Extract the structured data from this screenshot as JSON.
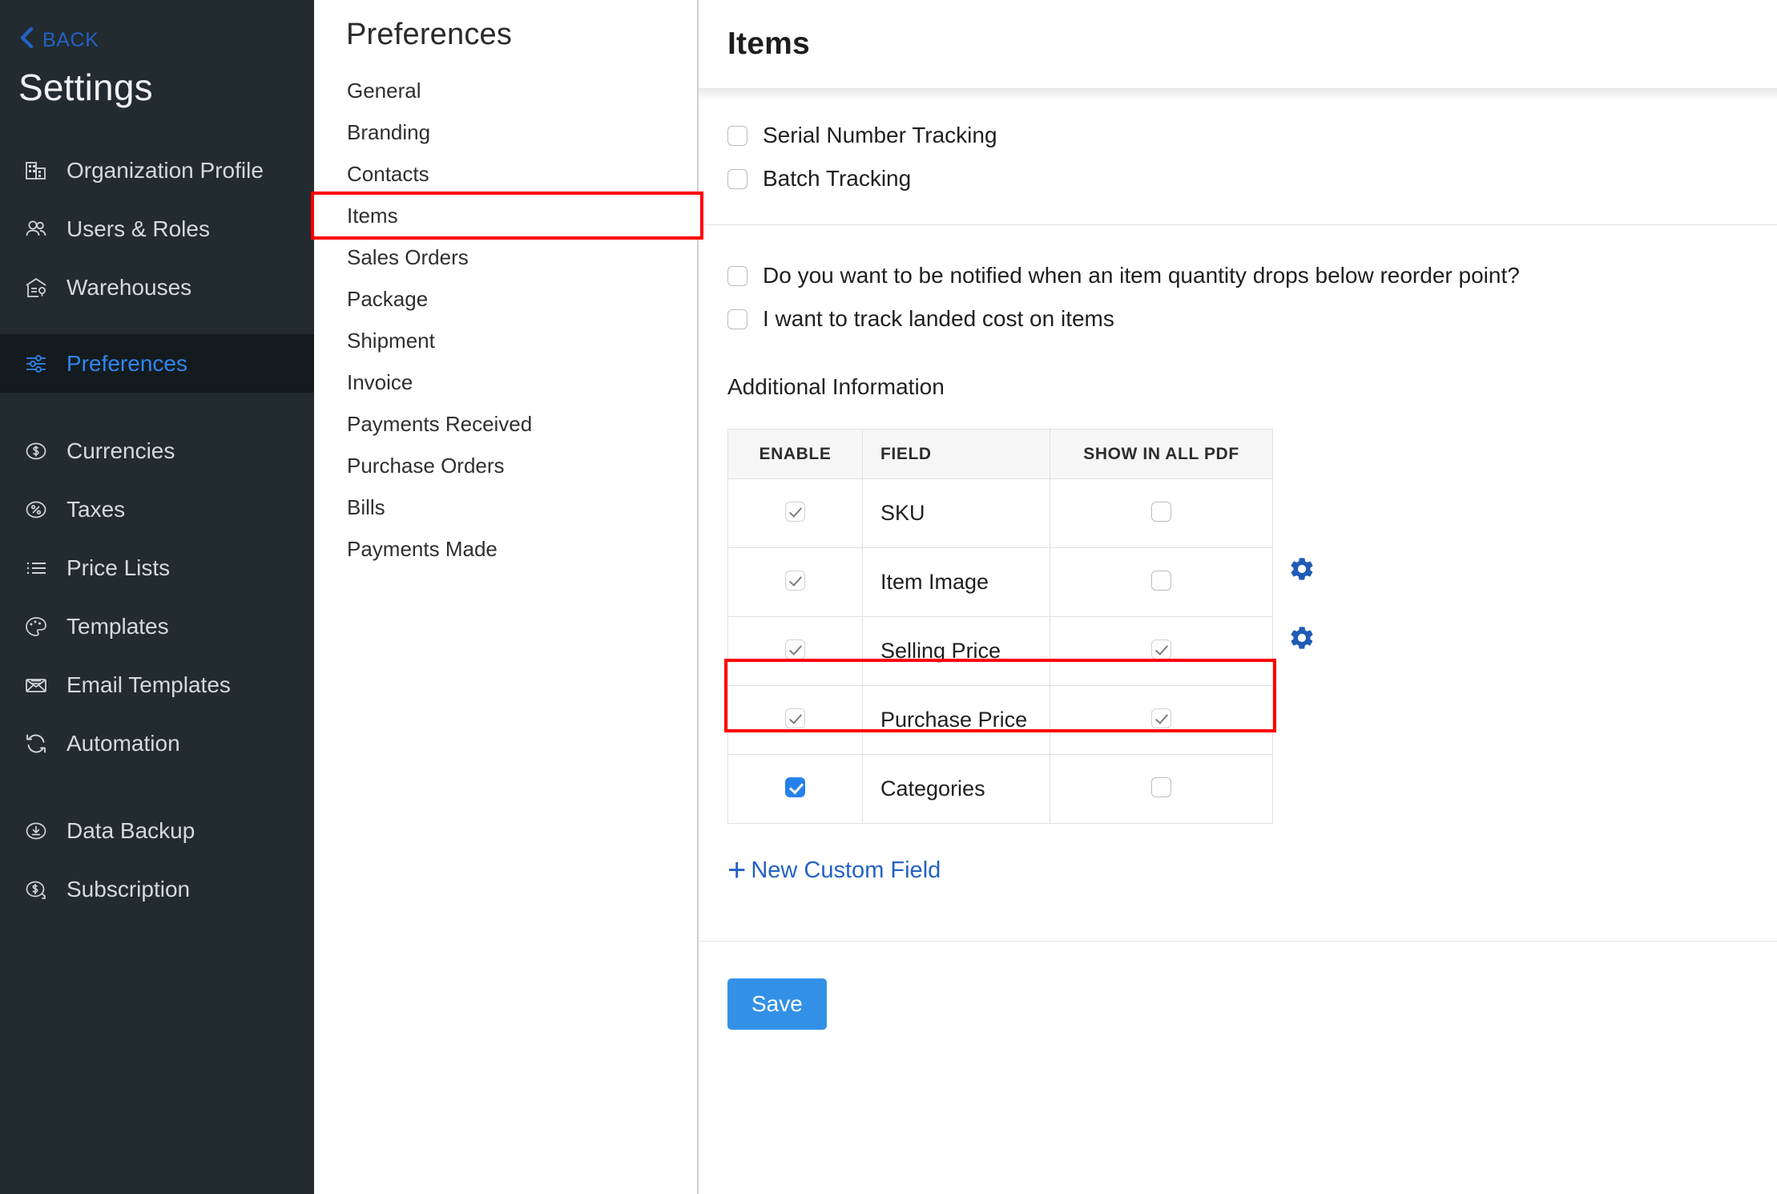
{
  "sidebar": {
    "back_label": "BACK",
    "title": "Settings",
    "groups": [
      {
        "items": [
          {
            "label": "Organization Profile",
            "icon": "building-icon",
            "active": false
          },
          {
            "label": "Users & Roles",
            "icon": "users-icon",
            "active": false
          },
          {
            "label": "Warehouses",
            "icon": "warehouse-icon",
            "active": false
          }
        ]
      },
      {
        "items": [
          {
            "label": "Preferences",
            "icon": "sliders-icon",
            "active": true
          }
        ]
      },
      {
        "items": [
          {
            "label": "Currencies",
            "icon": "dollar-circle-icon",
            "active": false
          },
          {
            "label": "Taxes",
            "icon": "percent-circle-icon",
            "active": false
          },
          {
            "label": "Price Lists",
            "icon": "list-icon",
            "active": false
          },
          {
            "label": "Templates",
            "icon": "palette-icon",
            "active": false
          },
          {
            "label": "Email Templates",
            "icon": "envelope-icon",
            "active": false
          },
          {
            "label": "Automation",
            "icon": "refresh-icon",
            "active": false
          }
        ]
      },
      {
        "items": [
          {
            "label": "Data Backup",
            "icon": "download-circle-icon",
            "active": false
          },
          {
            "label": "Subscription",
            "icon": "dollar-refresh-icon",
            "active": false
          }
        ]
      }
    ]
  },
  "preferences_panel": {
    "title": "Preferences",
    "items": [
      {
        "label": "General",
        "selected": false
      },
      {
        "label": "Branding",
        "selected": false
      },
      {
        "label": "Contacts",
        "selected": false
      },
      {
        "label": "Items",
        "selected": true
      },
      {
        "label": "Sales Orders",
        "selected": false
      },
      {
        "label": "Package",
        "selected": false
      },
      {
        "label": "Shipment",
        "selected": false
      },
      {
        "label": "Invoice",
        "selected": false
      },
      {
        "label": "Payments Received",
        "selected": false
      },
      {
        "label": "Purchase Orders",
        "selected": false
      },
      {
        "label": "Bills",
        "selected": false
      },
      {
        "label": "Payments Made",
        "selected": false
      }
    ]
  },
  "main": {
    "title": "Items",
    "tracking_options": [
      {
        "label": "Serial Number Tracking",
        "checked": false
      },
      {
        "label": "Batch Tracking",
        "checked": false
      }
    ],
    "notify_options": [
      {
        "label": "Do you want to be notified when an item quantity drops below reorder point?",
        "checked": false
      },
      {
        "label": "I want to track landed cost on items",
        "checked": false
      }
    ],
    "additional_information": {
      "section_label": "Additional Information",
      "columns": [
        "ENABLE",
        "FIELD",
        "SHOW IN ALL PDF"
      ],
      "rows": [
        {
          "field": "SKU",
          "enable": "checked-disabled",
          "show_in_pdf": "unchecked",
          "gear": false,
          "highlighted": false
        },
        {
          "field": "Item Image",
          "enable": "checked-disabled",
          "show_in_pdf": "unchecked",
          "gear": false,
          "highlighted": false
        },
        {
          "field": "Selling Price",
          "enable": "checked-disabled",
          "show_in_pdf": "checked-disabled",
          "gear": true,
          "highlighted": false
        },
        {
          "field": "Purchase Price",
          "enable": "checked-disabled",
          "show_in_pdf": "checked-disabled",
          "gear": true,
          "highlighted": false
        },
        {
          "field": "Categories",
          "enable": "checked",
          "show_in_pdf": "unchecked",
          "gear": false,
          "highlighted": true
        }
      ]
    },
    "new_custom_field_label": "New Custom Field",
    "new_custom_field_plus": "+",
    "save_label": "Save"
  },
  "colors": {
    "sidebar_bg": "#222b30",
    "sidebar_active_bg": "#141b1f",
    "accent_blue": "#2362c4",
    "link_blue": "#2e86ef",
    "checkbox_blue": "#2680eb",
    "gear_blue": "#1f5bb5",
    "save_blue": "#3291e6",
    "annotation_red": "#ff0000"
  }
}
